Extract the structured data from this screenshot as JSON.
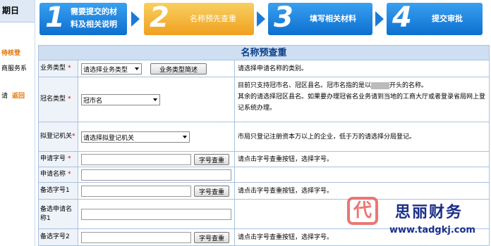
{
  "sidebar": {
    "header": "期日",
    "line1": "待核登",
    "line2": "商服务系",
    "line3": "请",
    "return_link": "返回"
  },
  "steps": [
    {
      "num": "1",
      "label_a": "需要提交的材",
      "label_b": "料及相关说明"
    },
    {
      "num": "2",
      "label_a": "名称预先查重",
      "label_b": ""
    },
    {
      "num": "3",
      "label_a": "填写相关材料",
      "label_b": ""
    },
    {
      "num": "4",
      "label_a": "提交审批",
      "label_b": ""
    }
  ],
  "form": {
    "title": "名称预查重",
    "business_type": {
      "label": "业务类型",
      "required": "*",
      "select_value": "请选择业务类型",
      "button": "业务类型简述",
      "hint": "请选择申请名称的类别。"
    },
    "crown_type": {
      "label": "冠名类型",
      "required": "*",
      "select_value": "冠市名",
      "hint_a": "目前只支持冠市名、冠区县名。冠市名指的是以",
      "hint_a2": "开头的名称。",
      "hint_b": "其余的请选择冠区县名。如果要办理冠省名业务请到当地的工商大厅或者登录省局网上登记系统办理。"
    },
    "reg_authority": {
      "label": "拟登记机关",
      "required": "*",
      "select_value": "请选择拟登记机关",
      "hint": "市局只登记注册资本万以上的企业，低于万的请选择分局登记。"
    },
    "name_code": {
      "label": "申请字号",
      "required": "*",
      "button": "字号查重",
      "hint": "请点击字号查重按钮，选择字号。"
    },
    "apply_name": {
      "label": "申请名称",
      "required": "*"
    },
    "alt_code1": {
      "label": "备选字号1",
      "button": "字号查重",
      "hint": "请点击字号查重按钮，选择字号。"
    },
    "alt_name1": {
      "label": "备选申请名称1"
    },
    "alt_code2": {
      "label": "备选字号2",
      "button": "字号查重",
      "hint": "请点击字号查重按钮，选择字号。"
    }
  },
  "watermark": {
    "logo_char": "代",
    "name": "思丽财务",
    "url": "www.tadgkj.com"
  },
  "colors": {
    "step_blue": "#0b6fd0",
    "step_active": "#f0a020",
    "required": "#d00000",
    "title_text": "#0a3e8c"
  }
}
